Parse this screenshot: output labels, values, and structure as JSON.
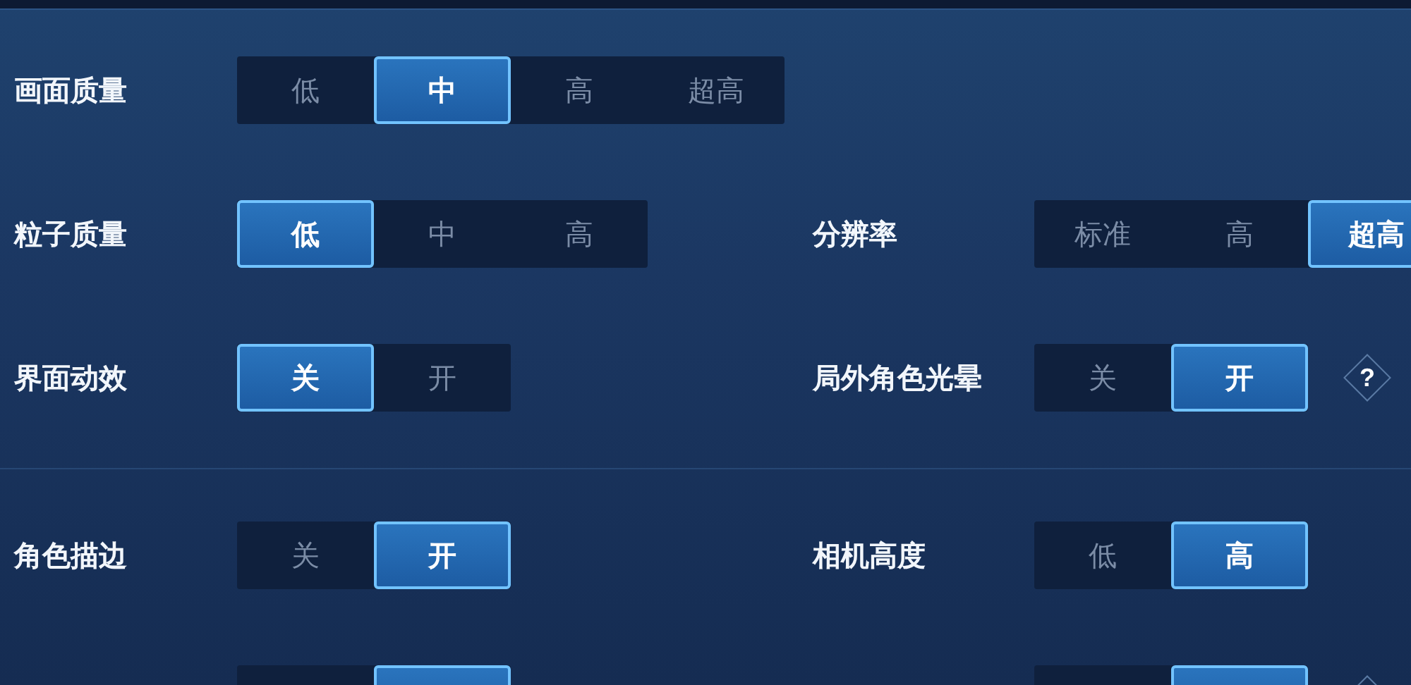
{
  "rows": [
    {
      "left": {
        "label": "画面质量",
        "options": [
          {
            "label": "低",
            "selected": false
          },
          {
            "label": "中",
            "selected": true
          },
          {
            "label": "高",
            "selected": false
          },
          {
            "label": "超高",
            "selected": false
          }
        ]
      }
    },
    {
      "left": {
        "label": "粒子质量",
        "options": [
          {
            "label": "低",
            "selected": true
          },
          {
            "label": "中",
            "selected": false
          },
          {
            "label": "高",
            "selected": false
          }
        ]
      },
      "right": {
        "label": "分辨率",
        "options": [
          {
            "label": "标准",
            "selected": false
          },
          {
            "label": "高",
            "selected": false
          },
          {
            "label": "超高",
            "selected": true
          }
        ]
      }
    },
    {
      "left": {
        "label": "界面动效",
        "options": [
          {
            "label": "关",
            "selected": true
          },
          {
            "label": "开",
            "selected": false
          }
        ]
      },
      "right": {
        "label": "局外角色光晕",
        "options": [
          {
            "label": "关",
            "selected": false
          },
          {
            "label": "开",
            "selected": true
          }
        ],
        "help": "?"
      }
    },
    {
      "left": {
        "label": "角色描边",
        "options": [
          {
            "label": "关",
            "selected": false
          },
          {
            "label": "开",
            "selected": true
          }
        ]
      },
      "right": {
        "label": "相机高度",
        "options": [
          {
            "label": "低",
            "selected": false
          },
          {
            "label": "高",
            "selected": true
          }
        ]
      }
    },
    {
      "left": {
        "options": [
          {
            "selected": false
          },
          {
            "selected": true
          }
        ]
      },
      "right": {
        "options": [
          {
            "selected": false
          },
          {
            "selected": true
          }
        ],
        "help": true
      }
    }
  ]
}
